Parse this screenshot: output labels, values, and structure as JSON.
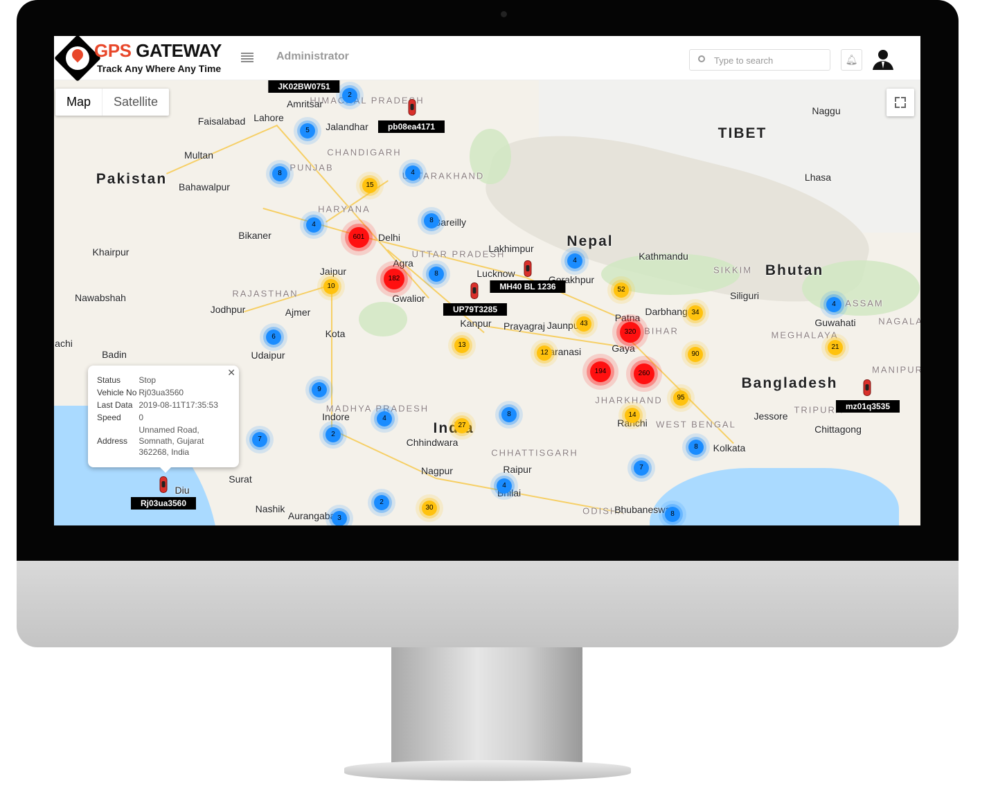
{
  "header": {
    "brand_accent": "GPS",
    "brand_main": "GATEWAY",
    "tagline": "Track Any Where Any Time",
    "role": "Administrator",
    "search_placeholder": "Type to search"
  },
  "map_controls": {
    "map": "Map",
    "satellite": "Satellite"
  },
  "colors": {
    "brand": "#e8472a",
    "cluster_blue": "#1a8cff",
    "cluster_yellow": "#ffc20e",
    "cluster_red": "#ff1010"
  },
  "countries": [
    "Pakistan",
    "India",
    "Nepal",
    "Bhutan",
    "Bangladesh",
    "TIBET"
  ],
  "states": [
    "PUNJAB",
    "HARYANA",
    "RAJASTHAN",
    "UTTAR PRADESH",
    "MADHYA PRADESH",
    "CHHATTISGARH",
    "JHARKHAND",
    "WEST BENGAL",
    "BIHAR",
    "ODISHA",
    "ASSAM",
    "MEGHALAYA",
    "SIKKIM",
    "CHANDIGARH",
    "HIMACHAL PRADESH",
    "UTTARAKHAND",
    "MANIPUR",
    "NAGALAND",
    "TRIPURA"
  ],
  "cities": [
    "Delhi",
    "Lahore",
    "Faisalabad",
    "Multan",
    "Bahawalpur",
    "Amritsar",
    "Jalandhar",
    "Jaipur",
    "Agra",
    "Lucknow",
    "Kathmandu",
    "Patna",
    "Kolkata",
    "Indore",
    "Nagpur",
    "Surat",
    "Nashik",
    "Raipur",
    "Kota",
    "Jodhpur",
    "Udaipur",
    "Bikaner",
    "Gwalior",
    "Prayagraj",
    "Gaya",
    "Darbhanga",
    "Guwahati",
    "Chittagong",
    "Lhasa",
    "Naggu",
    "Khairpur",
    "Nawabshah",
    "Badin",
    "Chhindwara",
    "Aurangabad",
    "Gorakhpur",
    "Siliguri",
    "Jessore",
    "Bhubaneswar",
    "Ajmer",
    "Bareilly",
    "Lakhimpur",
    "Varanasi",
    "Jaunpur",
    "Kanpur",
    "Ranchi",
    "Bhilai",
    "Diu",
    "achi"
  ],
  "clusters": [
    {
      "count": 2,
      "level": "blue"
    },
    {
      "count": 5,
      "level": "blue"
    },
    {
      "count": 8,
      "level": "blue"
    },
    {
      "count": 4,
      "level": "blue"
    },
    {
      "count": 4,
      "level": "blue"
    },
    {
      "count": 8,
      "level": "blue"
    },
    {
      "count": 4,
      "level": "blue"
    },
    {
      "count": 8,
      "level": "blue"
    },
    {
      "count": 6,
      "level": "blue"
    },
    {
      "count": 9,
      "level": "blue"
    },
    {
      "count": 4,
      "level": "blue"
    },
    {
      "count": 2,
      "level": "blue"
    },
    {
      "count": 7,
      "level": "blue"
    },
    {
      "count": 8,
      "level": "blue"
    },
    {
      "count": 4,
      "level": "blue"
    },
    {
      "count": 8,
      "level": "blue"
    },
    {
      "count": 7,
      "level": "blue"
    },
    {
      "count": 4,
      "level": "blue"
    },
    {
      "count": 2,
      "level": "blue"
    },
    {
      "count": 3,
      "level": "blue"
    },
    {
      "count": 8,
      "level": "blue"
    },
    {
      "count": 15,
      "level": "yellow"
    },
    {
      "count": 10,
      "level": "yellow"
    },
    {
      "count": 52,
      "level": "yellow"
    },
    {
      "count": 34,
      "level": "yellow"
    },
    {
      "count": 43,
      "level": "yellow"
    },
    {
      "count": 13,
      "level": "yellow"
    },
    {
      "count": 12,
      "level": "yellow"
    },
    {
      "count": 90,
      "level": "yellow"
    },
    {
      "count": 21,
      "level": "yellow"
    },
    {
      "count": 95,
      "level": "yellow"
    },
    {
      "count": 14,
      "level": "yellow"
    },
    {
      "count": 27,
      "level": "yellow"
    },
    {
      "count": 30,
      "level": "yellow"
    },
    {
      "count": 601,
      "level": "red"
    },
    {
      "count": 182,
      "level": "red"
    },
    {
      "count": 320,
      "level": "red"
    },
    {
      "count": 194,
      "level": "red"
    },
    {
      "count": 260,
      "level": "red"
    }
  ],
  "vehicles": [
    {
      "plate": "JK02BW0751"
    },
    {
      "plate": "pb08ea4171"
    },
    {
      "plate": "MH40 BL 1236"
    },
    {
      "plate": "UP79T3285"
    },
    {
      "plate": "mz01q3535"
    },
    {
      "plate": "Rj03ua3560"
    }
  ],
  "popup": {
    "rows": [
      {
        "label": "Status",
        "value": "Stop"
      },
      {
        "label": "Vehicle No",
        "value": "Rj03ua3560"
      },
      {
        "label": "Last Data",
        "value": "2019-08-11T17:35:53"
      },
      {
        "label": "Speed",
        "value": "0"
      }
    ],
    "address_label": "Address",
    "address_lines": [
      "Unnamed Road,",
      "Somnath, Gujarat",
      "362268, India"
    ]
  }
}
